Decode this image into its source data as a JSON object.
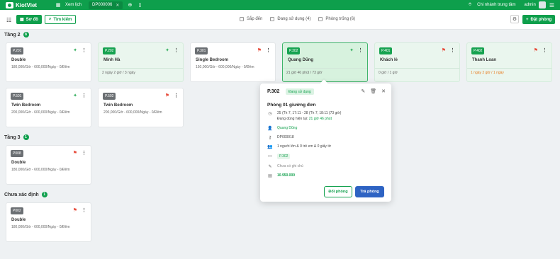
{
  "topbar": {
    "brand": "KiotViet",
    "tab_schedule": "Xem lịch",
    "tab_order": "DP000006",
    "branch": "Chi nhánh trung tâm",
    "user": "admin"
  },
  "toolbar": {
    "floor_plan_label": "Sơ đồ",
    "search_label": "Tìm kiếm",
    "filters": [
      {
        "label": "Sắp đến"
      },
      {
        "label": "Đang sử dụng (4)"
      },
      {
        "label": "Phòng trống (6)"
      }
    ],
    "book_label": "Đặt phòng"
  },
  "sections": [
    {
      "title": "Tầng 2",
      "count": "8"
    },
    {
      "title": "Tầng 3",
      "count": "1"
    },
    {
      "title": "Chưa xác định",
      "count": "1"
    }
  ],
  "rooms": [
    {
      "code": "P.201",
      "name": "Double",
      "price": "180,000/Giờ - 600,000/Ngày - 0/Đêm",
      "status": "",
      "state": "vacant",
      "clean": "clean"
    },
    {
      "code": "P.202",
      "name": "Minh Hà",
      "price": "",
      "status": "2 ngày 2 giờ / 3 ngày",
      "state": "occupied",
      "clean": "clean"
    },
    {
      "code": "P.301",
      "name": "Single Bedroom",
      "price": "150,000/Giờ - 600,000/Ngày - 0/Đêm",
      "status": "",
      "state": "vacant",
      "clean": "dirty"
    },
    {
      "code": "P.302",
      "name": "Quang Dũng",
      "price": "",
      "status": "21 giờ 46 phút / 73 giờ",
      "state": "selected",
      "clean": "clean"
    },
    {
      "code": "P.401",
      "name": "Khách lẻ",
      "price": "",
      "status": "0 giờ / 1 giờ",
      "state": "occupied",
      "clean": "dirty"
    },
    {
      "code": "P.402",
      "name": "Thanh Loan",
      "price": "",
      "status": "1 ngày 2 giờ / 1 ngày",
      "state": "occupied",
      "clean": "dirty",
      "warn": true
    },
    {
      "code": "P.501",
      "name": "Twin Bedroom",
      "price": "200,000/Giờ - 600,000/Ngày - 0/Đêm",
      "status": "",
      "state": "vacant",
      "clean": "clean"
    },
    {
      "code": "P.502",
      "name": "Twin Bedroom",
      "price": "200,000/Giờ - 600,000/Ngày - 0/Đêm",
      "status": "",
      "state": "vacant",
      "clean": "dirty"
    },
    {
      "code": "P008",
      "name": "Double",
      "price": "180,000/Giờ - 600,000/Ngày - 0/Đêm",
      "status": "",
      "state": "vacant",
      "clean": "dirty"
    },
    {
      "code": "P002",
      "name": "Double",
      "price": "180,000/Giờ - 600,000/Ngày - 0/Đêm",
      "status": "",
      "state": "vacant",
      "clean": "dirty"
    }
  ],
  "popover": {
    "room": "P.302",
    "status": "Đang sử dụng",
    "room_type": "Phòng 01 giường đơn",
    "dates": "25 (Th 7, 17:11 - 28 (Th 7, 18:11 (73 giờ)",
    "in_use_label": "Đang dùng hiện tại:",
    "in_use_value": "21 giờ 46 phút",
    "guest": "Quang Dũng",
    "booking_code": "DP000018",
    "occupants": "1 người lớn & 0 trẻ em & 0 giấy tờ",
    "room_tag": "P.302",
    "note": "Chưa có ghi chú",
    "amount": "10.950.000",
    "swap_label": "Đổi phòng",
    "pay_label": "Trả phòng"
  },
  "colors": {
    "brand": "#0e9f4c",
    "occupied": "#eaf6ee",
    "pay_button": "#2e63c3"
  },
  "icons": {
    "clean": "broom-sparkle-icon",
    "dirty": "broom-red-icon",
    "more": "more-vertical-icon"
  }
}
